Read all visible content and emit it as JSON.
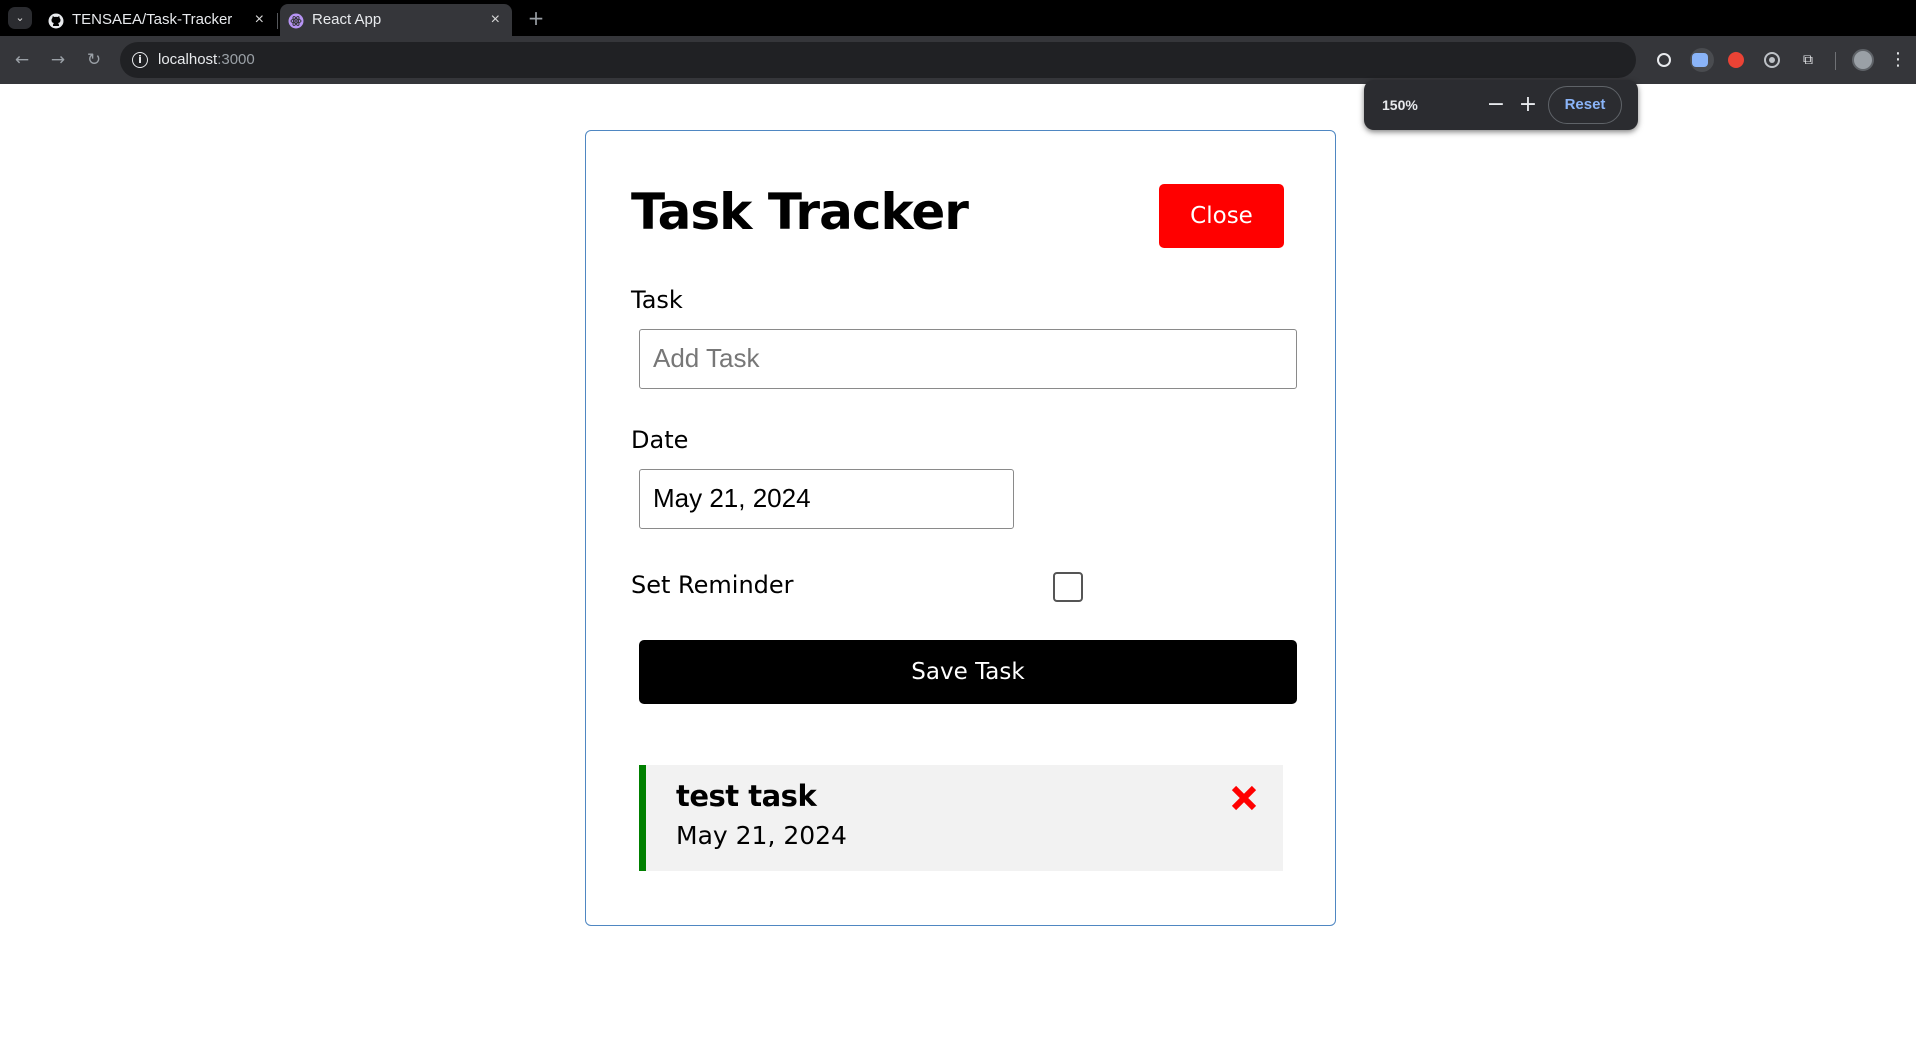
{
  "browser": {
    "tabs": [
      {
        "title": "TENSAEA/Task-Tracker",
        "icon": "github-icon",
        "active": false
      },
      {
        "title": "React App",
        "icon": "react-icon",
        "active": true
      }
    ],
    "new_tab_label": "+",
    "close_label": "×",
    "url": {
      "host": "localhost",
      "port": ":3000"
    }
  },
  "zoom_popup": {
    "level": "150%",
    "minus": "−",
    "plus": "+",
    "reset": "Reset"
  },
  "app": {
    "title": "Task Tracker",
    "close_button": "Close",
    "form": {
      "task_label": "Task",
      "task_placeholder": "Add Task",
      "task_value": "",
      "date_label": "Date",
      "date_value": "May 21, 2024",
      "reminder_label": "Set Reminder",
      "reminder_checked": false,
      "save_button": "Save Task"
    },
    "tasks": [
      {
        "text": "test task",
        "day": "May 21, 2024",
        "reminder": true
      }
    ]
  },
  "colors": {
    "close_button": "#ff0000",
    "save_button": "#000000",
    "reminder_border": "#008000",
    "delete_icon": "#ff0000",
    "container_border": "#4f87c2"
  }
}
